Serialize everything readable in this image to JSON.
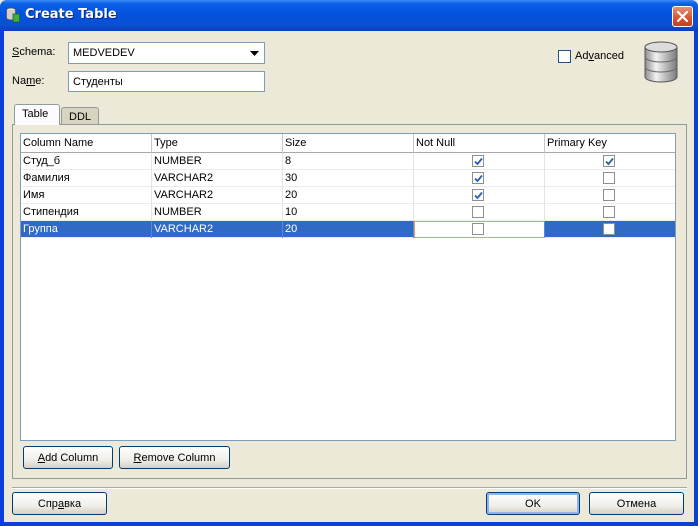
{
  "window": {
    "title": "Create Table"
  },
  "form": {
    "schema_label_u": "S",
    "schema_label_rest": "chema:",
    "schema_value": "MEDVEDEV",
    "name_label_pre": "Na",
    "name_label_u": "m",
    "name_label_rest": "e:",
    "name_value": "Студенты",
    "advanced_pre": "Ad",
    "advanced_u": "v",
    "advanced_rest": "anced",
    "advanced_checked": false
  },
  "tabs": [
    {
      "label": "Table",
      "active": true
    },
    {
      "label": "DDL",
      "active": false
    }
  ],
  "table": {
    "headers": [
      "Column Name",
      "Type",
      "Size",
      "Not Null",
      "Primary Key"
    ],
    "rows": [
      {
        "name": "Студ_б",
        "type": "NUMBER",
        "size": "8",
        "not_null": true,
        "pk": true
      },
      {
        "name": "Фамилия",
        "type": "VARCHAR2",
        "size": "30",
        "not_null": true,
        "pk": false
      },
      {
        "name": "Имя",
        "type": "VARCHAR2",
        "size": "20",
        "not_null": true,
        "pk": false
      },
      {
        "name": "Стипендия",
        "type": "NUMBER",
        "size": "10",
        "not_null": false,
        "pk": false
      },
      {
        "name": "Группа",
        "type": "VARCHAR2",
        "size": "20",
        "not_null": false,
        "pk": false,
        "selected": true
      }
    ]
  },
  "buttons": {
    "add_column_u": "A",
    "add_column_rest": "dd Column",
    "remove_column_u": "R",
    "remove_column_rest": "emove Column",
    "help_pre": "Спр",
    "help_u": "а",
    "help_rest": "вка",
    "ok": "OK",
    "cancel": "Отмена"
  },
  "colors": {
    "selection": "#316ac5",
    "titlebar": "#0353dd",
    "check": "#2b5fa6"
  },
  "icons": {
    "title": "database-table-icon",
    "database": "database-cylinder-icon",
    "close": "close-icon"
  }
}
